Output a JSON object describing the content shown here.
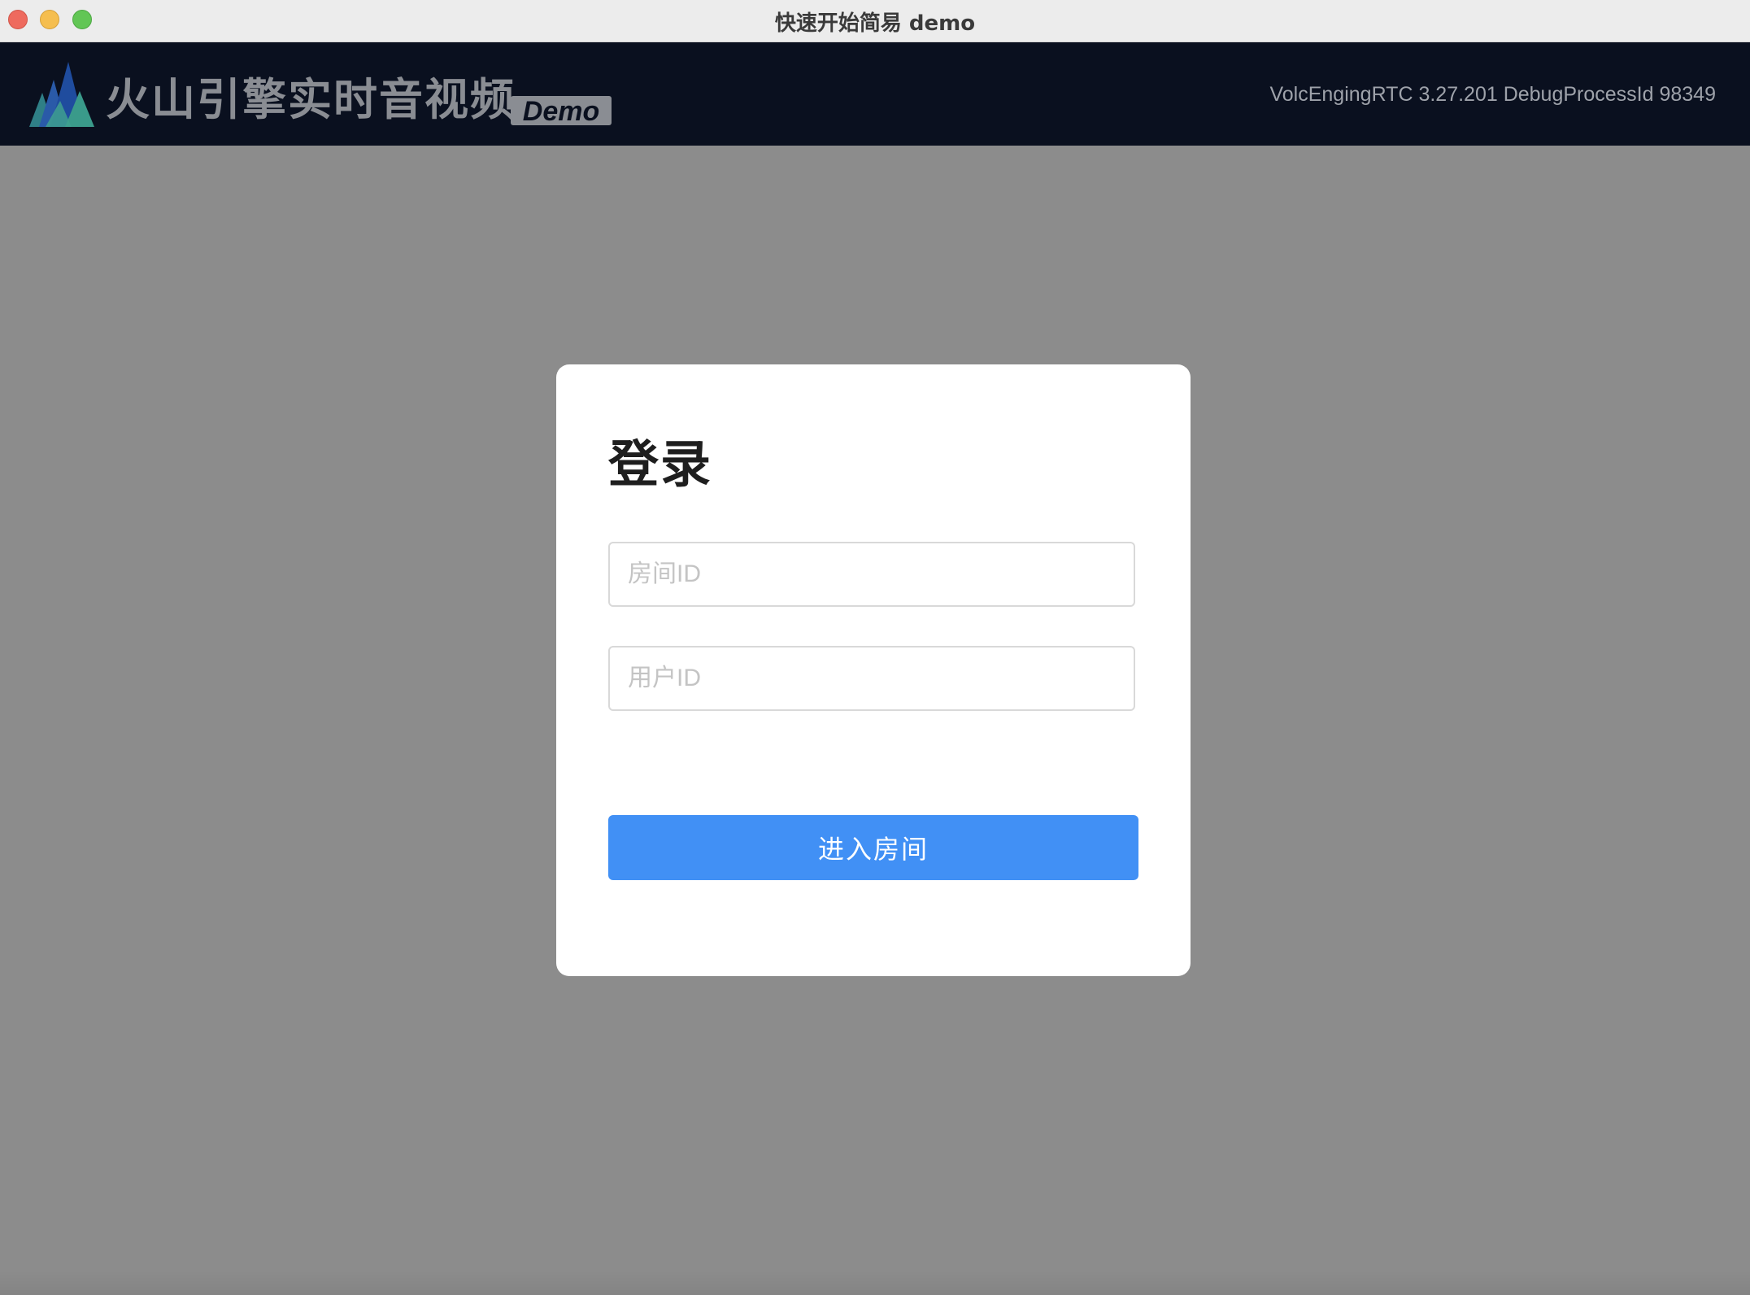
{
  "window": {
    "title": "快速开始简易 demo"
  },
  "header": {
    "brand_name": "火山引擎实时音视频",
    "demo_badge": "Demo",
    "version_info": "VolcEngingRTC 3.27.201 DebugProcessId 98349",
    "logo_icon": "volcano-mountains-icon"
  },
  "login": {
    "title": "登录",
    "room_id_placeholder": "房间ID",
    "room_id_value": "",
    "user_id_placeholder": "用户ID",
    "user_id_value": "",
    "enter_button_label": "进入房间"
  },
  "colors": {
    "header_bg": "#0a101f",
    "overlay_bg": "#8c8c8c",
    "button_bg": "#4190f5",
    "card_bg": "#ffffff"
  }
}
